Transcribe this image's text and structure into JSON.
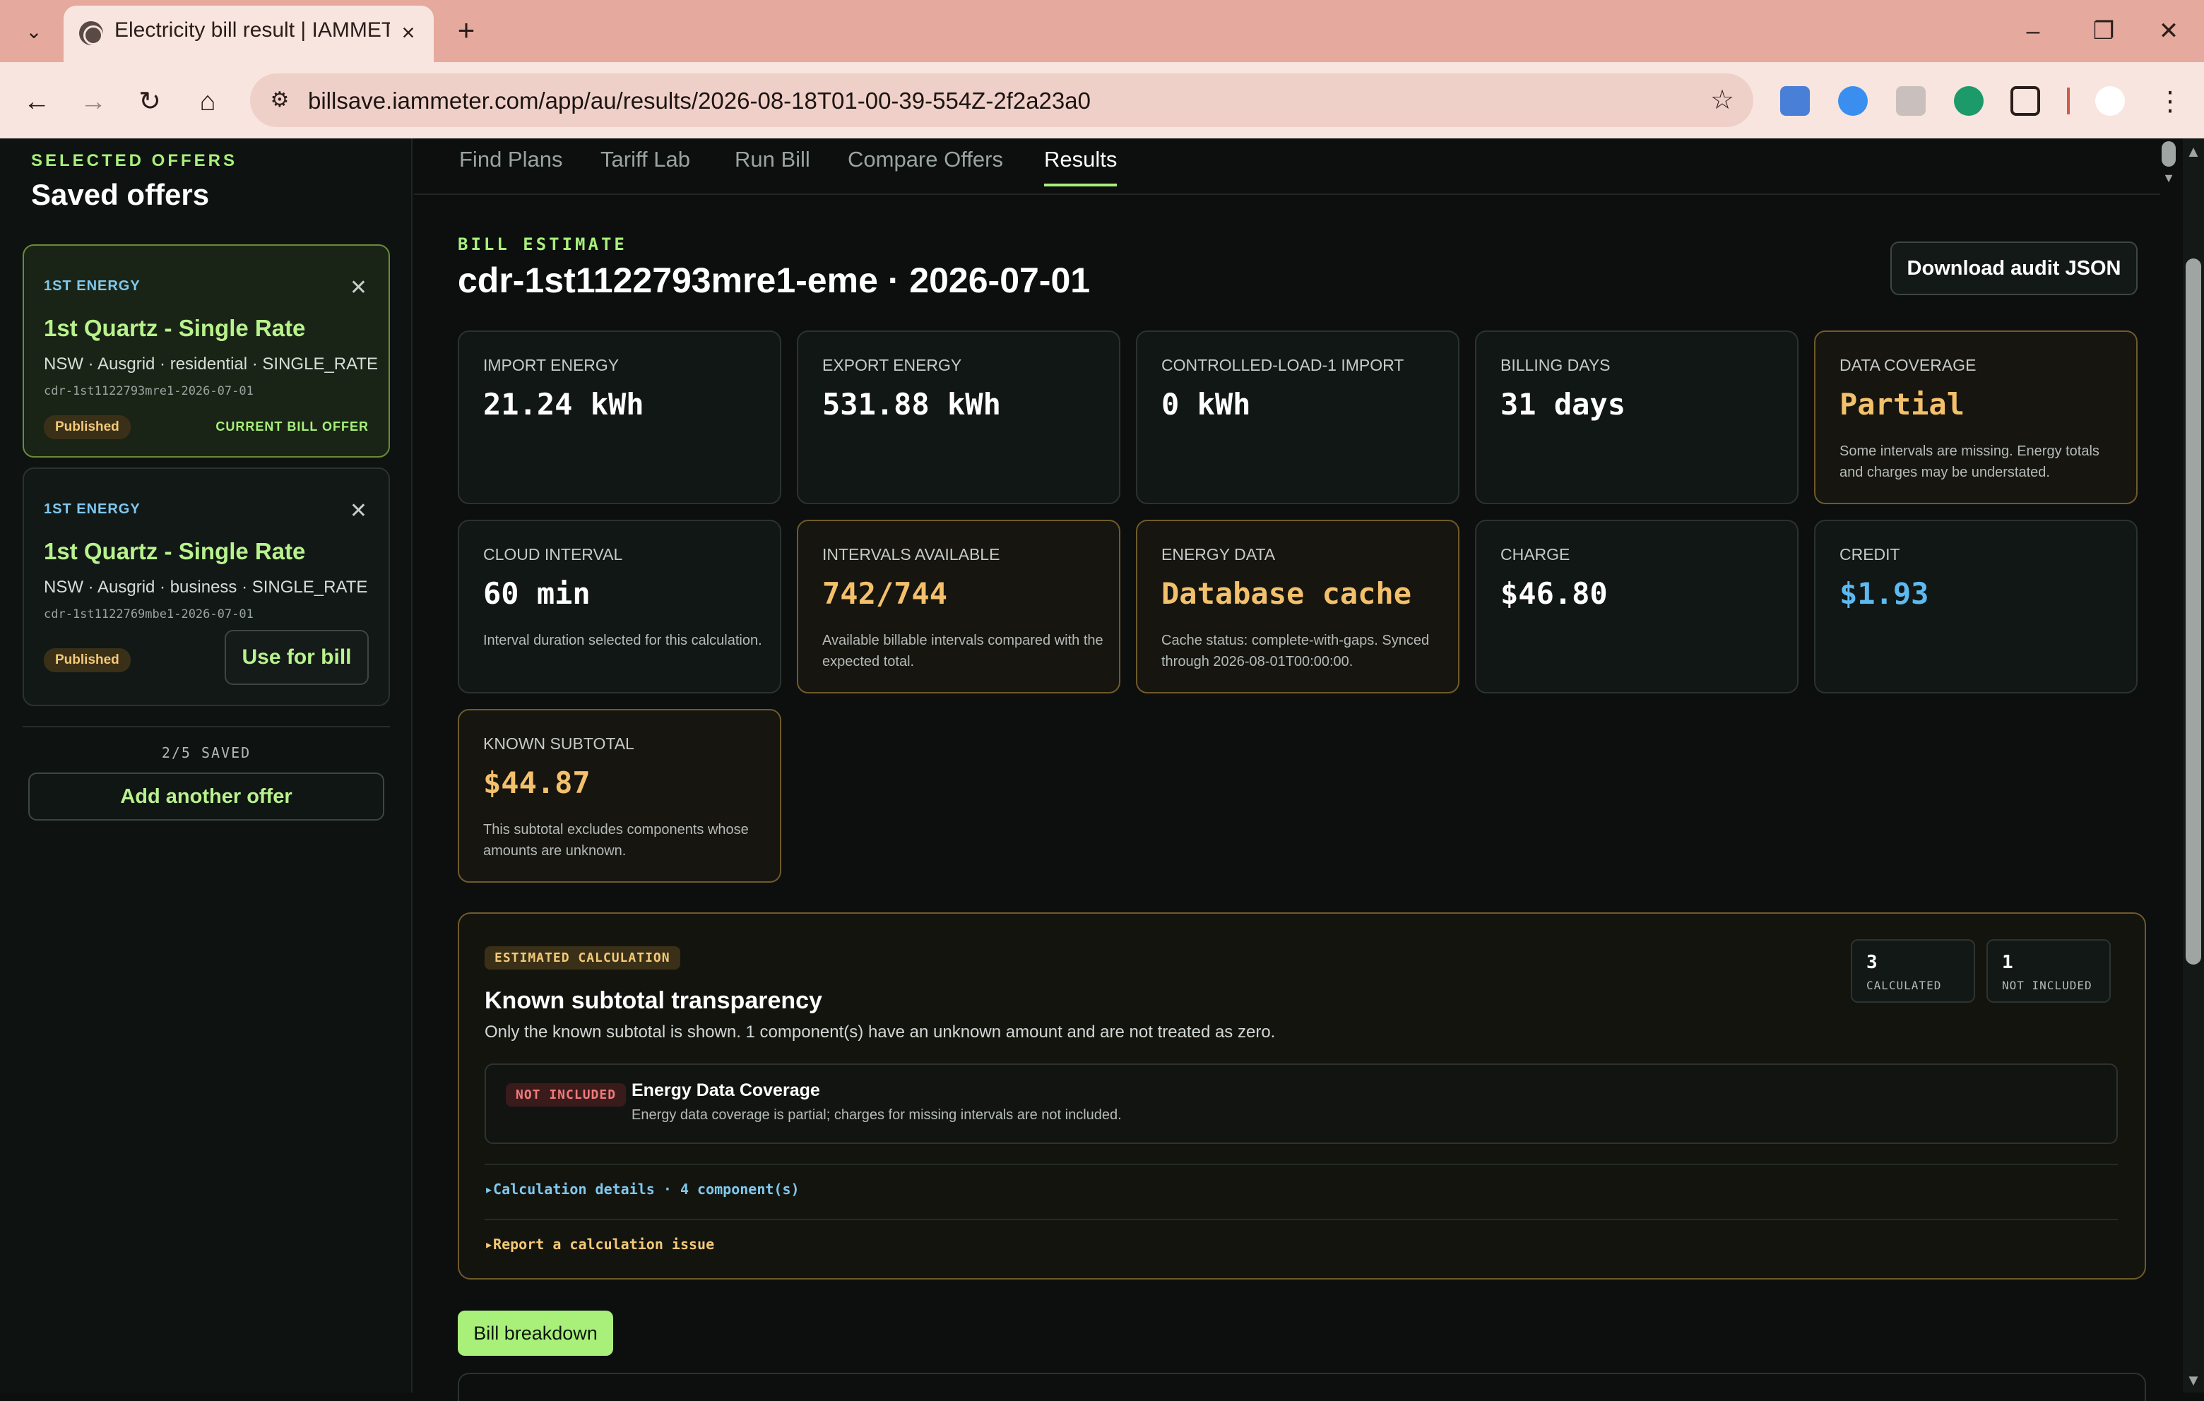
{
  "browser": {
    "tab_title": "Electricity bill result | IAMMETER",
    "url": "billsave.iammeter.com/app/au/results/2026-08-18T01-00-39-554Z-2f2a23a0"
  },
  "sidebar": {
    "eyebrow": "SELECTED OFFERS",
    "title": "Saved offers",
    "offers": [
      {
        "brand": "1ST ENERGY",
        "name": "1st Quartz - Single Rate",
        "meta": "NSW · Ausgrid · residential · SINGLE_RATE",
        "code": "cdr-1st1122793mre1-2026-07-01",
        "status": "Published",
        "current_label": "CURRENT BILL OFFER"
      },
      {
        "brand": "1ST ENERGY",
        "name": "1st Quartz - Single Rate",
        "meta": "NSW · Ausgrid · business · SINGLE_RATE",
        "code": "cdr-1st1122769mbe1-2026-07-01",
        "status": "Published",
        "use_label": "Use for bill"
      }
    ],
    "count": "2/5 SAVED",
    "add_label": "Add another offer"
  },
  "nav": {
    "tabs": [
      "Find Plans",
      "Tariff Lab",
      "Run Bill",
      "Compare Offers",
      "Results"
    ],
    "active": "Results"
  },
  "header": {
    "eyebrow": "BILL ESTIMATE",
    "title": "cdr-1st1122793mre1-eme · 2026-07-01",
    "download_label": "Download audit JSON"
  },
  "cards": [
    {
      "label": "IMPORT ENERGY",
      "value": "21.24 kWh",
      "note": ""
    },
    {
      "label": "EXPORT ENERGY",
      "value": "531.88 kWh",
      "note": ""
    },
    {
      "label": "CONTROLLED-LOAD-1 IMPORT",
      "value": "0 kWh",
      "note": ""
    },
    {
      "label": "BILLING DAYS",
      "value": "31 days",
      "note": ""
    },
    {
      "label": "DATA COVERAGE",
      "value": "Partial",
      "note": "Some intervals are missing. Energy totals and charges may be understated."
    },
    {
      "label": "CLOUD INTERVAL",
      "value": "60 min",
      "note": "Interval duration selected for this calculation."
    },
    {
      "label": "INTERVALS AVAILABLE",
      "value": "742/744",
      "note": "Available billable intervals compared with the expected total."
    },
    {
      "label": "ENERGY DATA",
      "value": "Database cache",
      "note": "Cache status: complete-with-gaps. Synced through 2026-08-01T00:00:00."
    },
    {
      "label": "CHARGE",
      "value": "$46.80",
      "note": ""
    },
    {
      "label": "CREDIT",
      "value": "$1.93",
      "note": ""
    },
    {
      "label": "KNOWN SUBTOTAL",
      "value": "$44.87",
      "note": "This subtotal excludes components whose amounts are unknown."
    }
  ],
  "transparency": {
    "badge": "ESTIMATED CALCULATION",
    "title": "Known subtotal transparency",
    "subtitle": "Only the known subtotal is shown. 1 component(s) have an unknown amount and are not treated as zero.",
    "stats": [
      {
        "n": "3",
        "label": "CALCULATED"
      },
      {
        "n": "1",
        "label": "NOT INCLUDED"
      }
    ],
    "component": {
      "badge": "NOT INCLUDED",
      "title": "Energy Data Coverage",
      "desc": "Energy data coverage is partial; charges for missing intervals are not included."
    },
    "details_label": "Calculation details · 4 component(s)",
    "report_label": "Report a calculation issue"
  },
  "bill_breakdown_label": "Bill breakdown",
  "colors": {
    "accent": "#a8f07a",
    "warning": "#f3c06b",
    "info": "#5cbaf0",
    "danger": "#f07a7a"
  }
}
